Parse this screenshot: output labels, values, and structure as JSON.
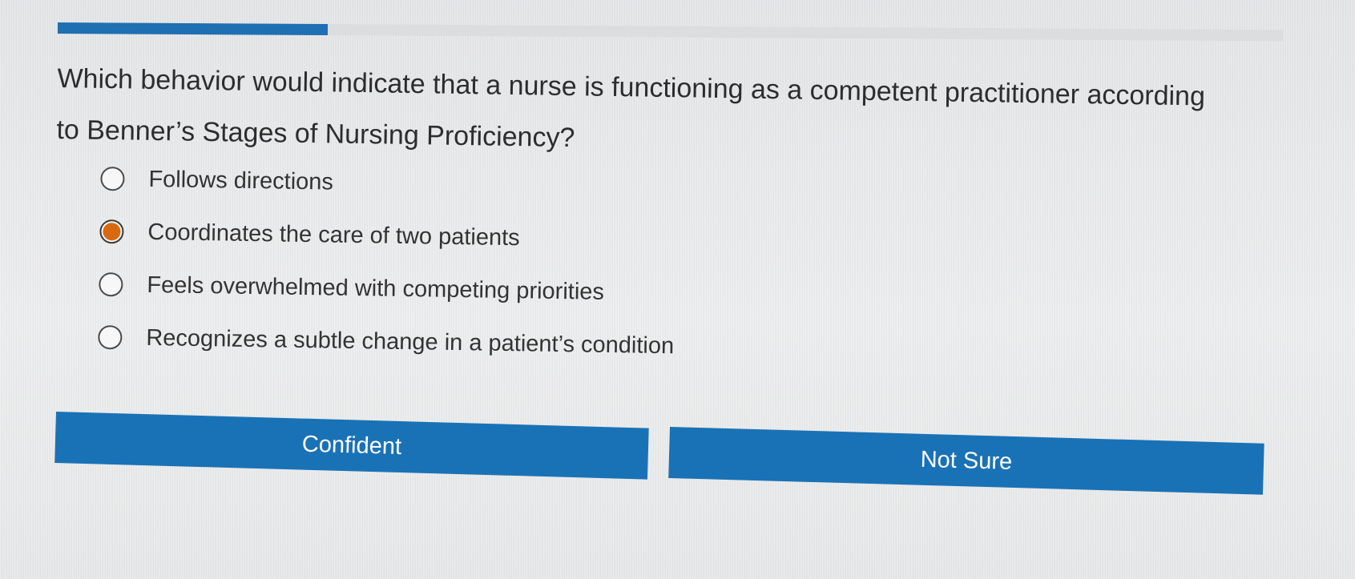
{
  "progress": {
    "fraction": 0.22,
    "fill_color": "#1f6fb3"
  },
  "question": {
    "text": "Which behavior would indicate that a nurse is functioning as a competent practitioner according to Benner’s Stages of Nursing Proficiency?"
  },
  "options": [
    {
      "label": "Follows directions",
      "selected": false
    },
    {
      "label": "Coordinates the care of two patients",
      "selected": true
    },
    {
      "label": "Feels overwhelmed with competing priorities",
      "selected": false
    },
    {
      "label": "Recognizes a subtle change in a patient’s condition",
      "selected": false
    }
  ],
  "buttons": {
    "confident_label": "Confident",
    "not_sure_label": "Not Sure"
  },
  "colors": {
    "accent": "#1a72b6",
    "selected_radio": "#d9690f"
  }
}
